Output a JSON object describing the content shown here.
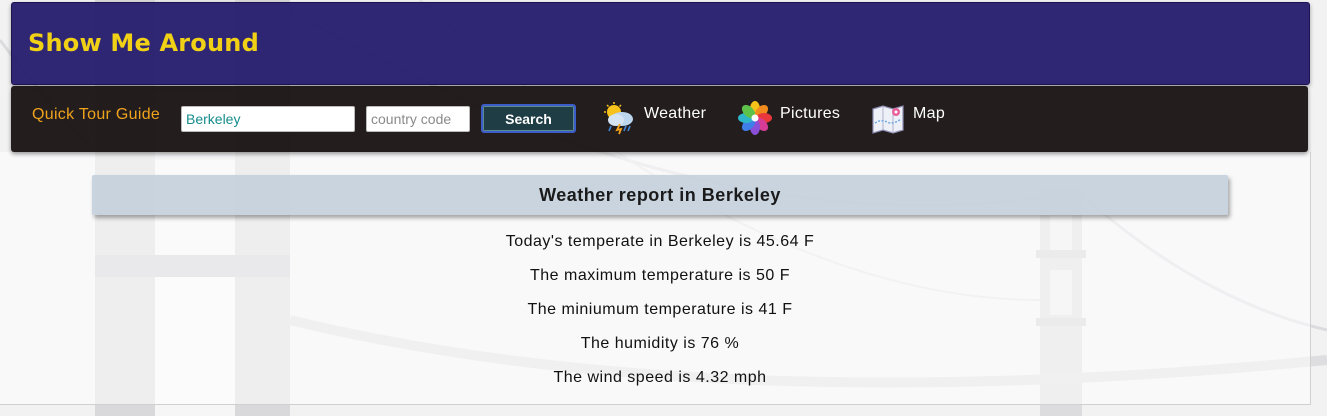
{
  "header": {
    "title": "Show Me Around"
  },
  "navbar": {
    "brand": "Quick Tour Guide",
    "city_input": {
      "value": "Berkeley",
      "placeholder": ""
    },
    "country_input": {
      "value": "",
      "placeholder": "country code"
    },
    "search_label": "Search",
    "links": [
      {
        "label": "Weather",
        "icon": "weather-icon"
      },
      {
        "label": "Pictures",
        "icon": "photos-icon"
      },
      {
        "label": "Map",
        "icon": "map-icon"
      }
    ]
  },
  "report": {
    "title": "Weather report in Berkeley",
    "lines": [
      "Today's temperate in Berkeley is 45.64 F",
      "The maximum temperature is 50 F",
      "The miniumum temperature is 41 F",
      "The humidity is 76 %",
      "The wind speed is 4.32 mph"
    ]
  },
  "colors": {
    "header_bg": "#281e6e",
    "title_text": "#f1d116",
    "navbar_bg": "#1c1616",
    "brand_text": "#f0a31c",
    "search_bg": "#1f3d44",
    "report_title_bg": "#c4d0dc"
  }
}
